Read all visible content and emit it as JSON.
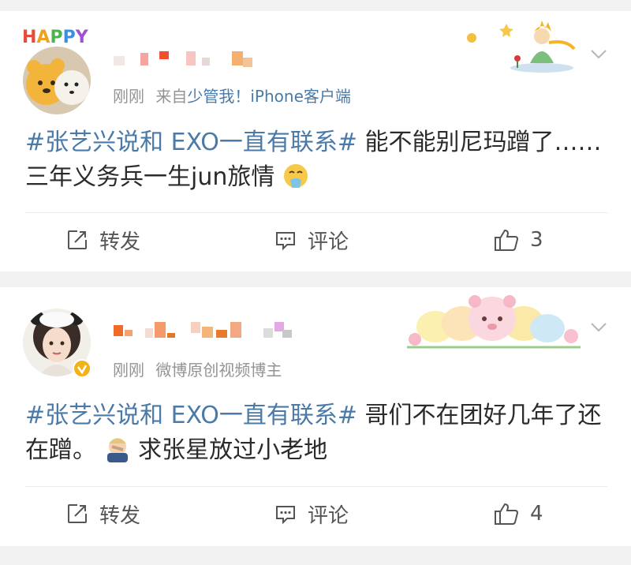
{
  "posts": [
    {
      "meta_time": "刚刚",
      "meta_from": "来自",
      "meta_source": "少管我！iPhone客户端",
      "badge_text": "HAPPY",
      "hashtag": "#张艺兴说和 EXO一直有联系#",
      "text_a": " 能不能别尼玛蹭了……三年义务兵一生jun旅情",
      "emoji": "vomit-emoji",
      "text_b": "",
      "actions": {
        "repost": "转发",
        "comment": "评论",
        "like_count": "3"
      }
    },
    {
      "meta_time": "刚刚",
      "meta_from": "",
      "meta_source": "微博原创视频博主",
      "badge_text": "",
      "hashtag": "#张艺兴说和 EXO一直有联系#",
      "text_a": " 哥们不在团好几年了还在蹭。",
      "emoji": "man-facepalm-emoji",
      "text_b": " 求张星放过小老地",
      "actions": {
        "repost": "转发",
        "comment": "评论",
        "like_count": "4"
      }
    }
  ],
  "colors": {
    "link_blue": "#4a7aa8",
    "meta_gray": "#939393",
    "verified_badge": "#f2b21a"
  }
}
